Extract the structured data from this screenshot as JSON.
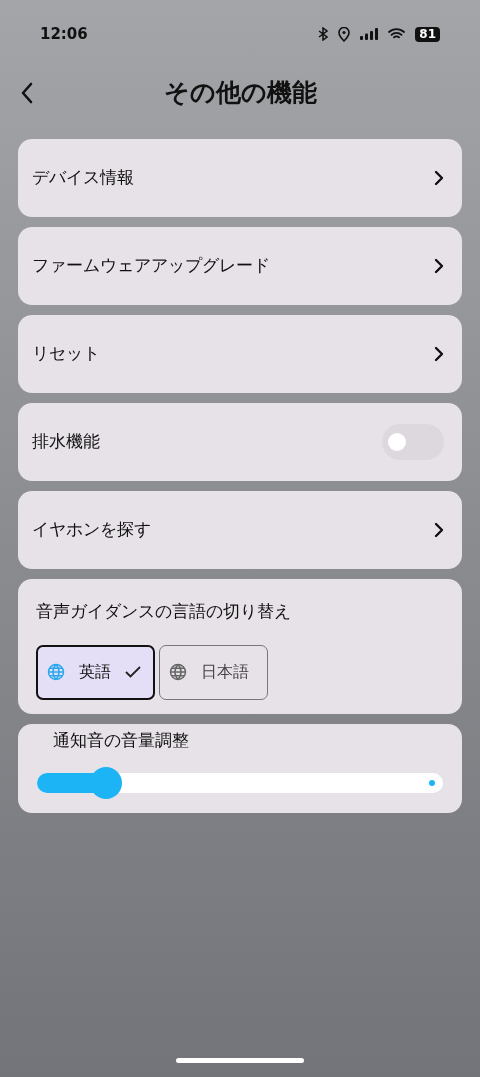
{
  "status_bar": {
    "time": "12:06",
    "battery": "81"
  },
  "header": {
    "title": "その他の機能"
  },
  "rows": [
    {
      "kind": "link",
      "label": "デバイス情報"
    },
    {
      "kind": "link",
      "label": "ファームウェアアップグレード"
    },
    {
      "kind": "link",
      "label": "リセット"
    },
    {
      "kind": "toggle",
      "label": "排水機能",
      "on": false
    },
    {
      "kind": "link",
      "label": "イヤホンを探す"
    }
  ],
  "language": {
    "title": "音声ガイダンスの言語の切り替え",
    "options": [
      {
        "label": "英語",
        "selected": true
      },
      {
        "label": "日本語",
        "selected": false
      }
    ]
  },
  "volume": {
    "title": "通知音の音量調整",
    "level": 0.17
  }
}
